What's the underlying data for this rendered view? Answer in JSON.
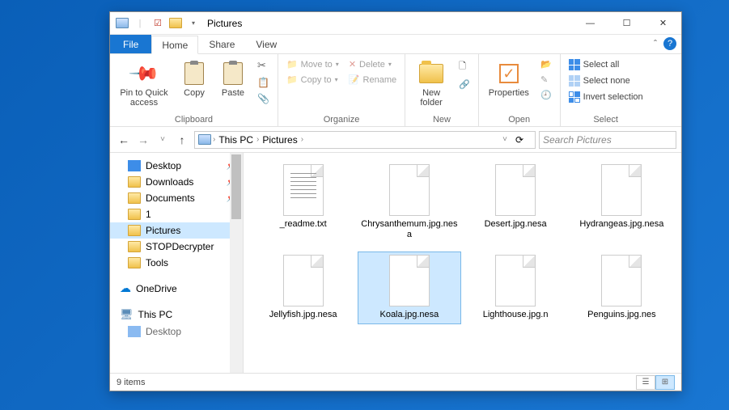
{
  "window": {
    "title": "Pictures",
    "controls": {
      "minimize": "—",
      "maximize": "☐",
      "close": "✕"
    }
  },
  "ribbon": {
    "file_tab": "File",
    "tabs": [
      "Home",
      "Share",
      "View"
    ],
    "active_tab": 0,
    "collapse": "ˆ",
    "help": "?",
    "groups": {
      "clipboard": {
        "label": "Clipboard",
        "pin": "Pin to Quick access",
        "copy": "Copy",
        "paste": "Paste",
        "cut": "Cut",
        "copy_path": "Copy path",
        "paste_shortcut": "Paste shortcut"
      },
      "organize": {
        "label": "Organize",
        "move_to": "Move to",
        "copy_to": "Copy to",
        "delete": "Delete",
        "rename": "Rename"
      },
      "new": {
        "label": "New",
        "new_folder": "New folder",
        "new_item": "New item",
        "easy_access": "Easy access"
      },
      "open": {
        "label": "Open",
        "properties": "Properties",
        "open": "Open",
        "edit": "Edit",
        "history": "History"
      },
      "select": {
        "label": "Select",
        "select_all": "Select all",
        "select_none": "Select none",
        "invert": "Invert selection"
      }
    }
  },
  "addressbar": {
    "crumbs": [
      "This PC",
      "Pictures"
    ],
    "search_placeholder": "Search Pictures"
  },
  "navpane": {
    "quick": [
      {
        "label": "Desktop",
        "type": "desktop",
        "pinned": true
      },
      {
        "label": "Downloads",
        "type": "folder",
        "pinned": true
      },
      {
        "label": "Documents",
        "type": "folder",
        "pinned": true
      },
      {
        "label": "1",
        "type": "folder",
        "pinned": false
      },
      {
        "label": "Pictures",
        "type": "folder",
        "pinned": false,
        "selected": true
      },
      {
        "label": "STOPDecrypter",
        "type": "folder",
        "pinned": false
      },
      {
        "label": "Tools",
        "type": "folder",
        "pinned": false
      }
    ],
    "onedrive": "OneDrive",
    "thispc": "This PC",
    "desktop2": "Desktop"
  },
  "files": [
    {
      "name": "_readme.txt",
      "type": "txt"
    },
    {
      "name": "Chrysanthemum.jpg.nesa",
      "type": "file"
    },
    {
      "name": "Desert.jpg.nesa",
      "type": "file"
    },
    {
      "name": "Hydrangeas.jpg.nesa",
      "type": "file"
    },
    {
      "name": "Jellyfish.jpg.nesa",
      "type": "file"
    },
    {
      "name": "Koala.jpg.nesa",
      "type": "file",
      "selected": true
    },
    {
      "name": "Lighthouse.jpg.n",
      "type": "file"
    },
    {
      "name": "Penguins.jpg.nes",
      "type": "file"
    }
  ],
  "statusbar": {
    "count": "9 items"
  }
}
